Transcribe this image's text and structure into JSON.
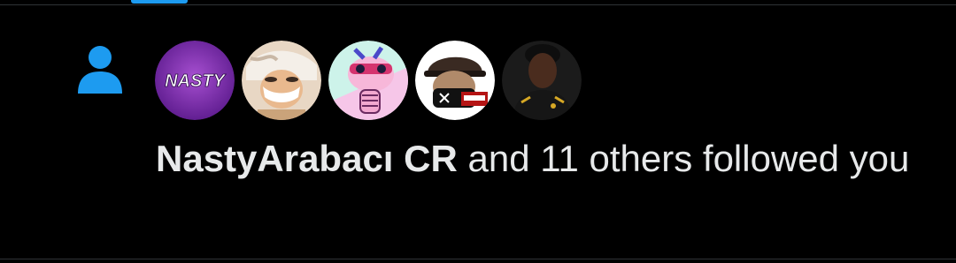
{
  "notification": {
    "type_icon": "person-icon",
    "actor_name": "NastyArabacı CR",
    "action_text": "and 11 others followed you",
    "avatars": [
      {
        "label": "NASTY",
        "icon": "nasty-logo-avatar"
      },
      {
        "label": "",
        "icon": "anime-character-avatar"
      },
      {
        "label": "",
        "icon": "cartoon-pink-character-avatar"
      },
      {
        "label": "",
        "icon": "cartoon-cap-character-avatar"
      },
      {
        "label": "",
        "icon": "footballer-photo-avatar"
      }
    ]
  },
  "colors": {
    "background": "#000000",
    "text": "#e7e9ea",
    "accent": "#1d9bf0",
    "divider": "#2f3336"
  }
}
